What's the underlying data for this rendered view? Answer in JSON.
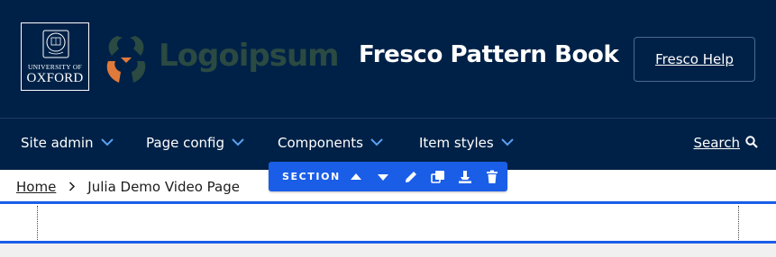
{
  "header": {
    "oxford_logo": {
      "line1": "UNIVERSITY OF",
      "line2": "OXFORD"
    },
    "partner_logo_text": "Logoipsum",
    "site_title": "Fresco Pattern Book",
    "help_button_label": "Fresco Help"
  },
  "nav": {
    "items": [
      {
        "label": "Site admin",
        "icon": "chevron-down-icon"
      },
      {
        "label": "Page config",
        "icon": "chevron-down-icon"
      },
      {
        "label": "Components",
        "icon": "chevron-down-icon"
      },
      {
        "label": "Item styles",
        "icon": "chevron-down-icon"
      }
    ],
    "search_label": "Search",
    "search_icon": "search-icon"
  },
  "breadcrumb": {
    "home": "Home",
    "separator_icon": "chevron-right-icon",
    "current": "Julia Demo Video Page"
  },
  "section_toolbar": {
    "label": "SECTION",
    "icons": [
      "move-up-icon",
      "move-down-icon",
      "edit-icon",
      "duplicate-icon",
      "save-icon",
      "delete-icon"
    ]
  },
  "colors": {
    "header_bg": "#002147",
    "accent_blue": "#1a5ee8",
    "chevron_blue": "#5aa0f0",
    "logoipsum_green": "#2a4a42",
    "logoipsum_orange": "#e07a3a"
  }
}
